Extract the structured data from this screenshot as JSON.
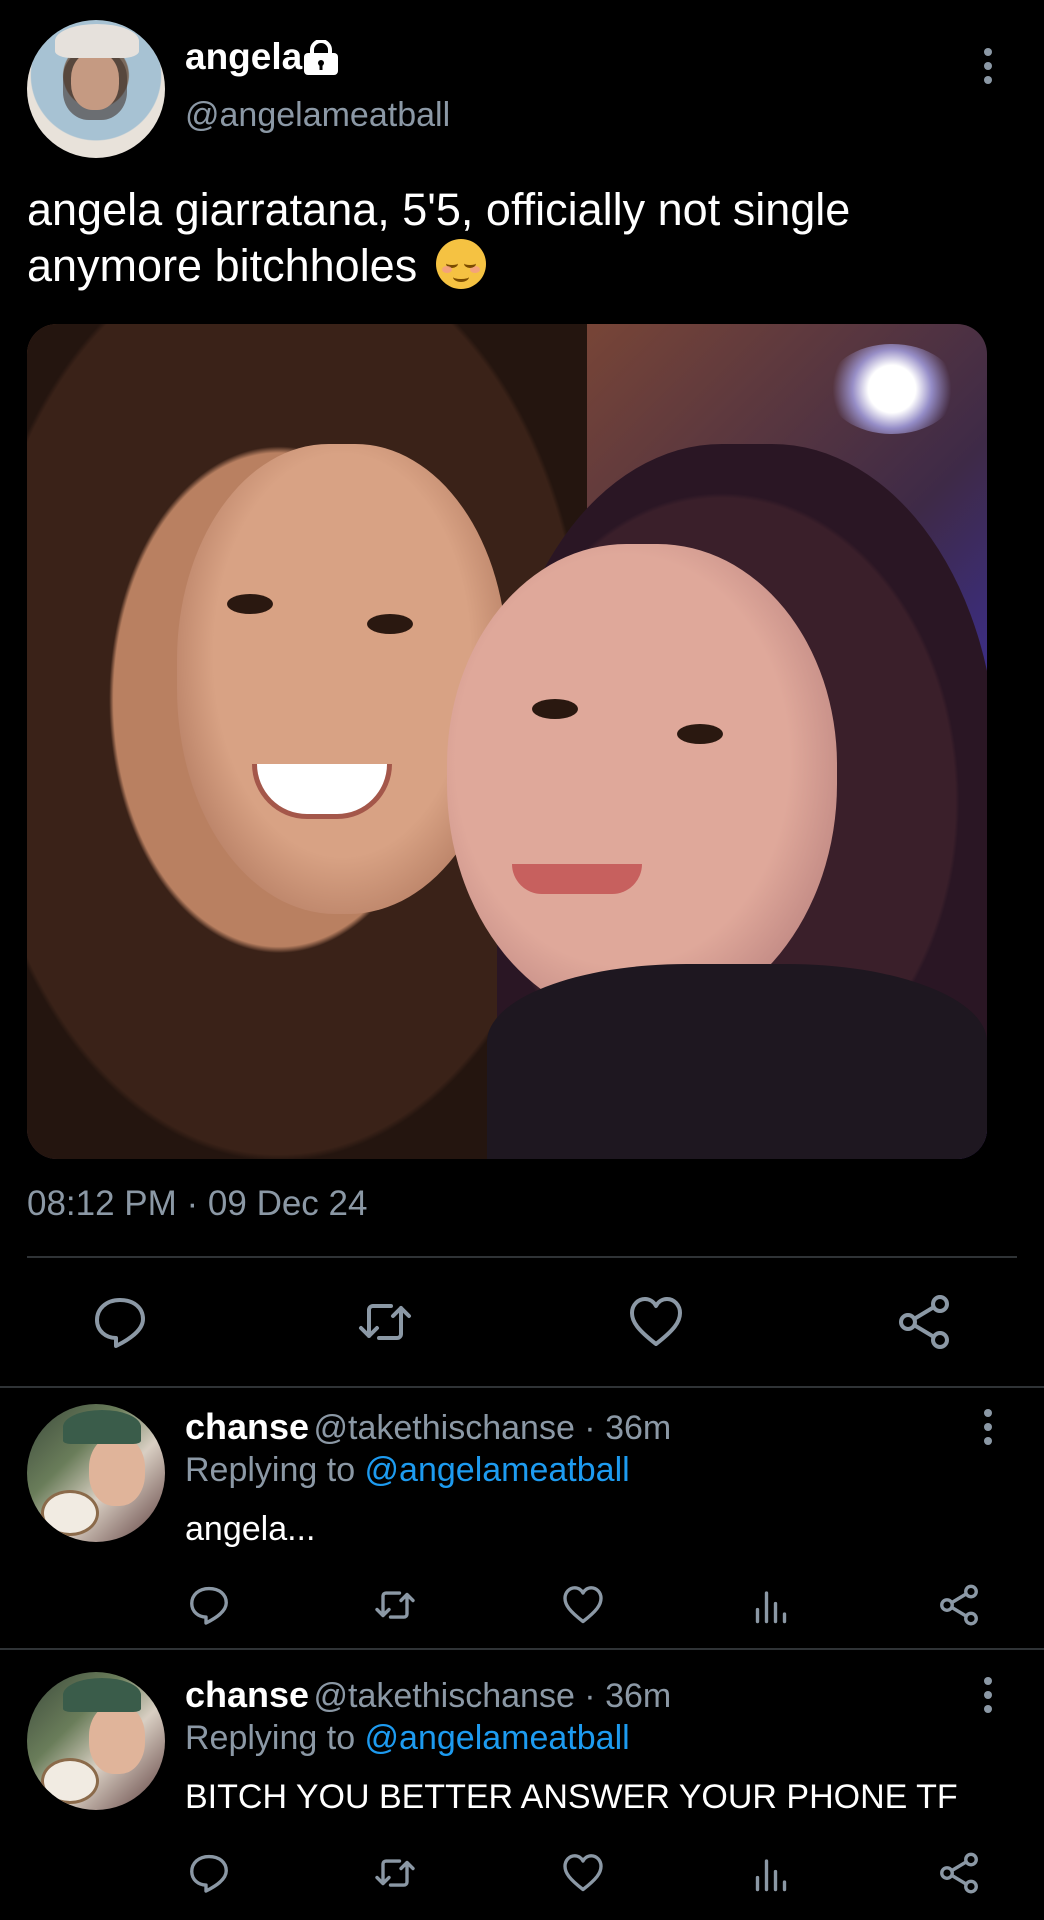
{
  "tweet": {
    "name": "angela",
    "handle": "@angelameatball",
    "text": "angela giarratana, 5'5, officially not single anymore bitchholes",
    "emoji": "relieved-face-emoji",
    "timestamp": "08:12 PM · 09 Dec 24",
    "actions": [
      "reply-icon",
      "retweet-icon",
      "like-icon",
      "share-icon"
    ]
  },
  "replies": [
    {
      "name": "chanse",
      "handle_time": "@takethischanse · 36m",
      "replying_prefix": "Replying to ",
      "replying_handle": "@angelameatball",
      "text": "angela..."
    },
    {
      "name": "chanse",
      "handle_time": "@takethischanse · 36m",
      "replying_prefix": "Replying to ",
      "replying_handle": "@angelameatball",
      "text": "BITCH YOU BETTER ANSWER YOUR PHONE TF"
    }
  ],
  "colors": {
    "background": "#000000",
    "text": "#ffffff",
    "secondary": "#8b98a5",
    "accent": "#1d9bf0",
    "divider": "#2f3336"
  }
}
